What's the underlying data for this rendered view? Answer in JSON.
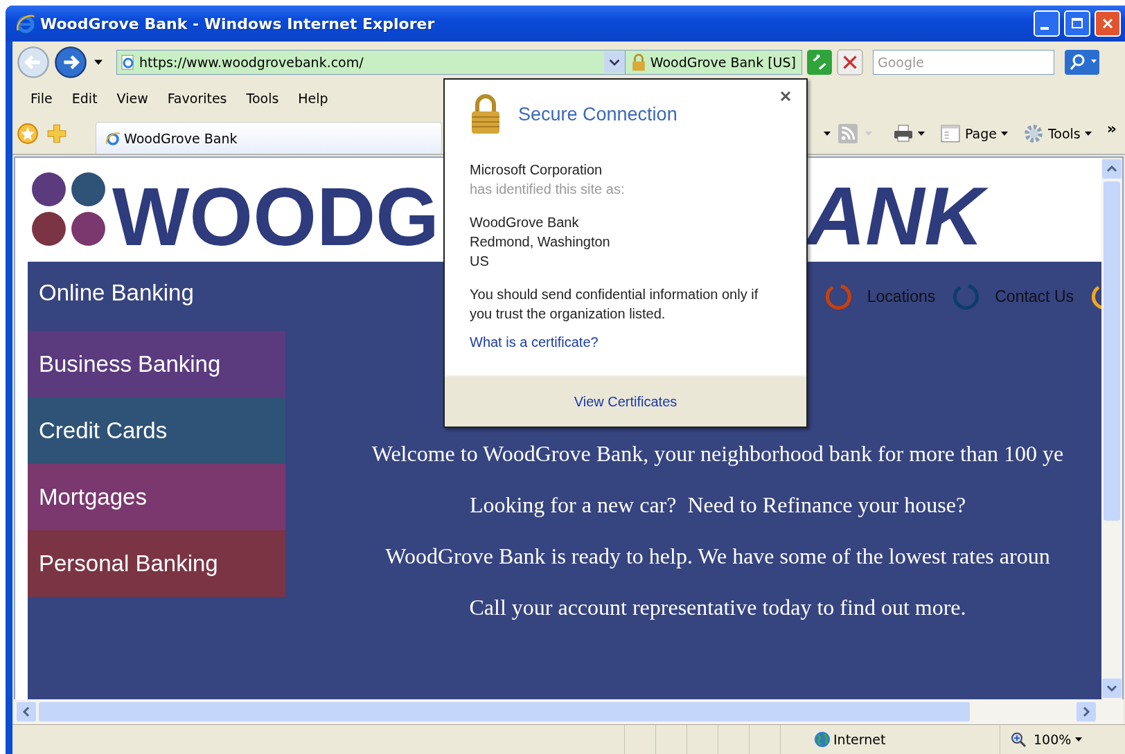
{
  "window": {
    "title": "WoodGrove Bank - Windows Internet Explorer"
  },
  "address_bar": {
    "url": "https://www.woodgrovebank.com/",
    "identity": "WoodGrove Bank [US]",
    "secure": true
  },
  "search": {
    "placeholder": "Google"
  },
  "menu": [
    "File",
    "Edit",
    "View",
    "Favorites",
    "Tools",
    "Help"
  ],
  "tabs": [
    {
      "label": "WoodGrove Bank",
      "selected": true
    }
  ],
  "command_bar": [
    {
      "kind": "print"
    },
    {
      "kind": "menu",
      "label": "Page"
    },
    {
      "kind": "menu",
      "label": "Tools"
    }
  ],
  "command_overflow": "»",
  "page": {
    "logo": [
      "WOODG",
      "ANK"
    ],
    "nav_links": [
      {
        "label": "Locations",
        "color": "#c8400c"
      },
      {
        "label": "Contact Us",
        "color": "#0d3d6b"
      }
    ],
    "side_menu": [
      {
        "label": "Online Banking",
        "color": "#364480"
      },
      {
        "label": "Business Banking",
        "color": "#5b3a7e"
      },
      {
        "label": "Credit Cards",
        "color": "#2f5277"
      },
      {
        "label": "Mortgages",
        "color": "#7a386e"
      },
      {
        "label": "Personal Banking",
        "color": "#7b3443"
      }
    ],
    "paragraphs": [
      "Welcome to WoodGrove Bank, your neighborhood bank for more than 100 ye",
      "Looking for a new car?  Need to Refinance your house?",
      "WoodGrove Bank is ready to help. We have some of the lowest rates aroun",
      "Call your account representative today to find out more."
    ]
  },
  "popup": {
    "title": "Secure Connection",
    "issuer": "Microsoft Corporation",
    "issuer_note": "has identified this site as:",
    "identity_lines": [
      "WoodGrove Bank",
      "Redmond, Washington",
      "US"
    ],
    "warning": "You should send confidential information only if you trust the organization listed.",
    "link": "What is a certificate?",
    "button": "View Certificates"
  },
  "status_bar": {
    "zone": "Internet",
    "zoom": "100%"
  }
}
